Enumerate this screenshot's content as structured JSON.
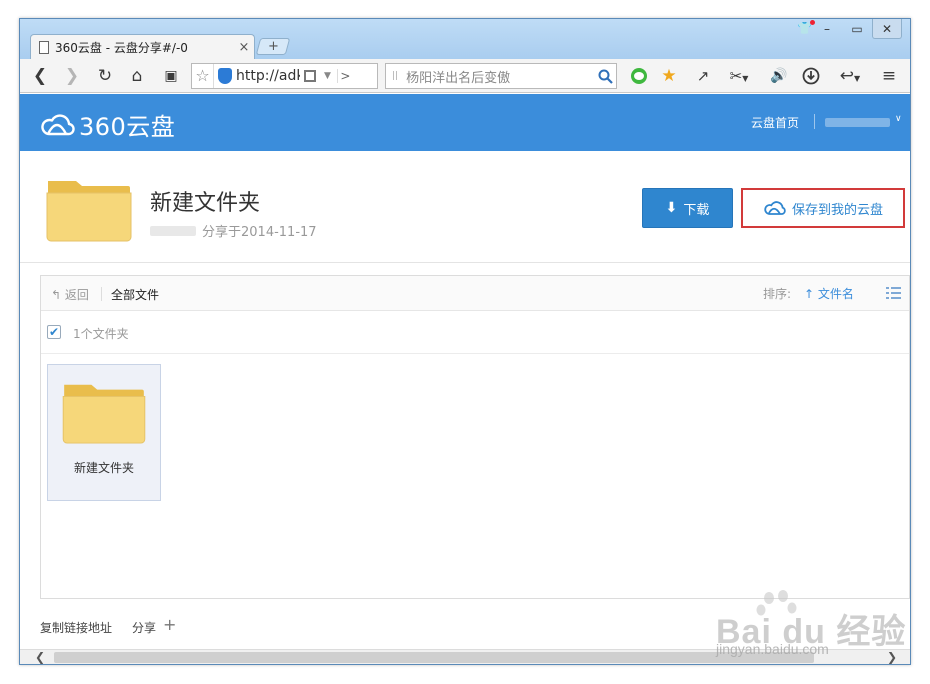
{
  "browser": {
    "tab_title": "360云盘 - 云盘分享#/-0",
    "new_tab_label": "+",
    "address_url": "http://adk",
    "search_placeholder": "杨阳洋出名后变傲"
  },
  "header": {
    "logo_text": "360云盘",
    "nav_home": "云盘首页"
  },
  "share": {
    "title": "新建文件夹",
    "shared_date_text": "分享于2014-11-17",
    "download_label": "下载",
    "save_label": "保存到我的云盘"
  },
  "file_browser": {
    "back_label": "返回",
    "all_files_label": "全部文件",
    "sort_label": "排序:",
    "sort_field": "文件名",
    "selection_count": "1个文件夹",
    "items": [
      {
        "name": "新建文件夹",
        "type": "folder"
      }
    ]
  },
  "footer": {
    "copy_link_label": "复制链接地址",
    "share_label": "分享",
    "share_plus": "+"
  },
  "watermark": {
    "brand_text": "Bai du 经验",
    "url_text": "jingyan.baidu.com"
  },
  "colors": {
    "header_blue": "#3b8ddb",
    "download_button": "#2f86cf",
    "save_highlight_border": "#d23a3a",
    "folder_yellow": "#f6d77a"
  },
  "icons": {
    "tab": "document-icon",
    "back": "back-arrow-icon",
    "forward": "forward-arrow-icon",
    "reload": "reload-icon",
    "home": "home-icon",
    "bookmark": "bookmark-icon",
    "search": "magnifier-icon",
    "view_toggle": "list-view-icon",
    "sort": "sort-up-arrow-icon"
  }
}
